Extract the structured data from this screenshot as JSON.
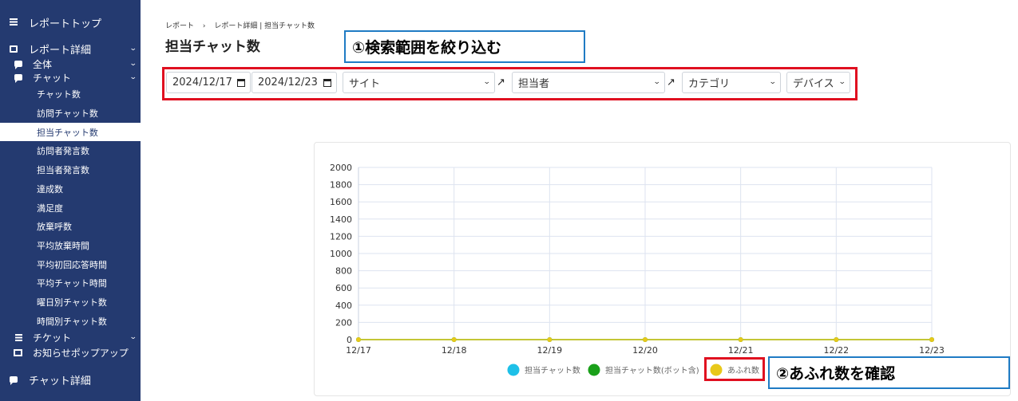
{
  "sidebar": {
    "report_top": "レポートトップ",
    "report_detail": "レポート詳細",
    "all": "全体",
    "chat": "チャット",
    "chat_items": [
      "チャット数",
      "訪問チャット数",
      "担当チャット数",
      "訪問者発言数",
      "担当者発言数",
      "達成数",
      "満足度",
      "放棄呼数",
      "平均放棄時間",
      "平均初回応答時間",
      "平均チャット時間",
      "曜日別チャット数",
      "時間別チャット数"
    ],
    "ticket": "チケット",
    "popup": "お知らせポップアップ",
    "chat_detail": "チャット詳細"
  },
  "breadcrumb": [
    "レポート",
    "›",
    "レポート詳細 | 担当チャット数"
  ],
  "page_title": "担当チャット数",
  "callouts": {
    "narrow": "①検索範囲を絞り込む",
    "confirm": "②あふれ数を確認"
  },
  "filters": {
    "date_from": "2024/12/17",
    "date_to": "2024/12/23",
    "site": "サイト",
    "operator": "担当者",
    "category": "カテゴリ",
    "device": "デバイス"
  },
  "icons": {
    "expand": "↗"
  },
  "chart_data": {
    "type": "line",
    "categories": [
      "12/17",
      "12/18",
      "12/19",
      "12/20",
      "12/21",
      "12/22",
      "12/23"
    ],
    "ylim": [
      0,
      2000
    ],
    "yticks": [
      0,
      200,
      400,
      600,
      800,
      1000,
      1200,
      1400,
      1600,
      1800,
      2000
    ],
    "grid": true,
    "legend_position": "bottom",
    "series": [
      {
        "name": "担当チャット数",
        "color": "#1ec0e8",
        "values": [
          0,
          0,
          0,
          0,
          0,
          0,
          0
        ]
      },
      {
        "name": "担当チャット数(ボット含)",
        "color": "#1aa01a",
        "values": [
          0,
          0,
          0,
          0,
          0,
          0,
          0
        ]
      },
      {
        "name": "あふれ数",
        "color": "#e8c81a",
        "values": [
          0,
          0,
          0,
          0,
          0,
          0,
          0
        ]
      }
    ]
  }
}
